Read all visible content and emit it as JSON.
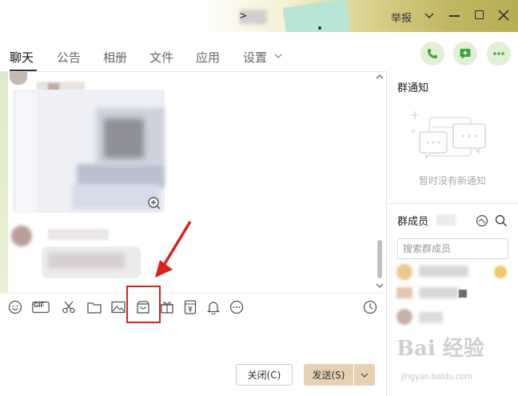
{
  "window": {
    "title_glyph": ">",
    "report_label": "举报",
    "accent_color": "#3aa83a"
  },
  "tabs": [
    {
      "label": "聊天",
      "active": true
    },
    {
      "label": "公告"
    },
    {
      "label": "相册"
    },
    {
      "label": "文件"
    },
    {
      "label": "应用"
    },
    {
      "label": "设置"
    }
  ],
  "header_actions": [
    "phone-icon",
    "add-message-icon",
    "more-icon"
  ],
  "toolbar": {
    "icons": [
      "emoji-icon",
      "gif-icon",
      "scissors-icon",
      "folder-icon",
      "image-icon",
      "shop-icon",
      "gift-icon",
      "red-packet-icon",
      "bell-icon",
      "more-icon"
    ],
    "gif_label": "GIF",
    "history_icon": "clock-icon"
  },
  "composer": {
    "close_label": "关闭(C)",
    "send_label": "发送(S)"
  },
  "notice_panel": {
    "title": "群通知",
    "empty_text": "暂时没有新通知"
  },
  "members_panel": {
    "title": "群成员",
    "search_placeholder": "搜索群成员"
  },
  "watermark": {
    "brand": "Bai 经验",
    "url": "jingyan.baidu.com"
  }
}
